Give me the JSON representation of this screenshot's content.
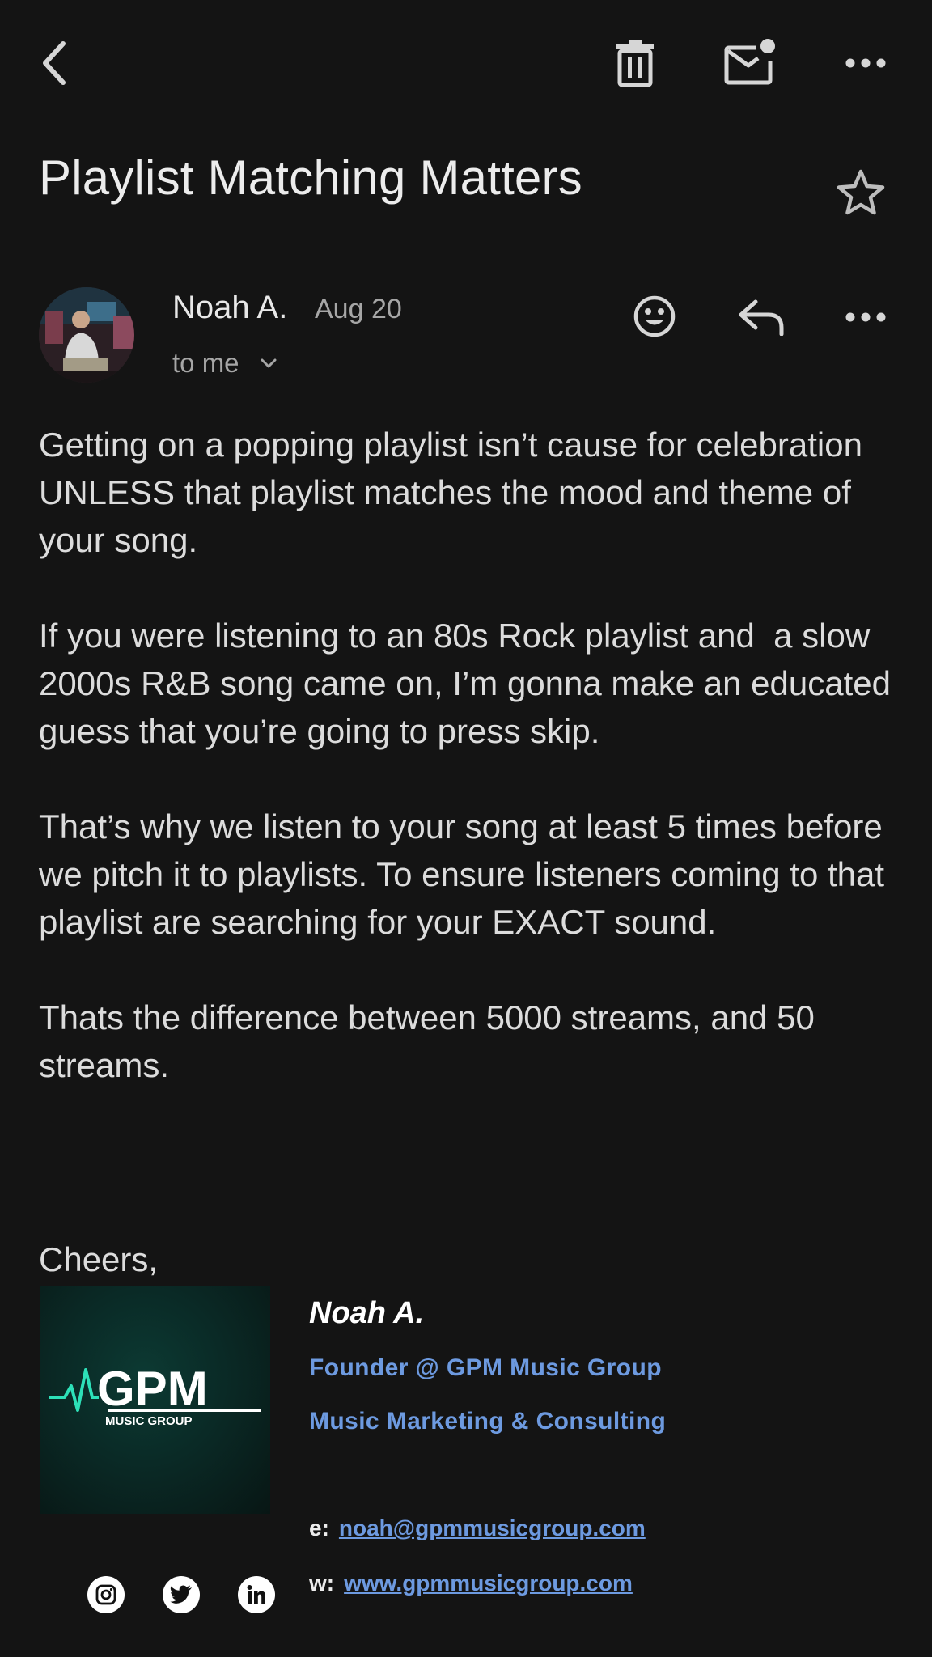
{
  "subject": "Playlist Matching Matters",
  "sender": {
    "name": "Noah A.",
    "date": "Aug 20",
    "recipient": "to me"
  },
  "body": {
    "paragraphs": [
      "Getting on a popping playlist isn’t cause for celebration UNLESS that playlist matches the mood and theme of your song.",
      "If you were listening to an 80s Rock playlist and  a slow 2000s R&B song came on, I’m gonna make an educated guess that you’re going to press skip.",
      "That’s why we listen to your song at least 5 times before we pitch it to playlists. To ensure listeners coming to that playlist are searching for your EXACT sound.",
      "Thats the difference between 5000 streams, and 50 streams."
    ],
    "signoff": "Cheers,"
  },
  "signature": {
    "name": "Noah A.",
    "role": "Founder @ GPM Music Group",
    "tagline": "Music Marketing & Consulting",
    "email_label": "e:",
    "email": "noah@gpmmusicgroup.com",
    "web_label": "w:",
    "website": "www.gpmmusicgroup.com",
    "logo_text": "GPM",
    "logo_subtext": "MUSIC GROUP"
  },
  "icons": {
    "back": "chevron-left-icon",
    "delete": "trash-icon",
    "mark_unread": "mail-unread-icon",
    "more": "more-horizontal-icon",
    "star": "star-outline-icon",
    "react": "emoji-icon",
    "reply": "reply-icon",
    "social": [
      "instagram-icon",
      "twitter-icon",
      "linkedin-icon"
    ]
  },
  "colors": {
    "background": "#141414",
    "link": "#6d9ae0",
    "logo_accent": "#2de0b8"
  }
}
